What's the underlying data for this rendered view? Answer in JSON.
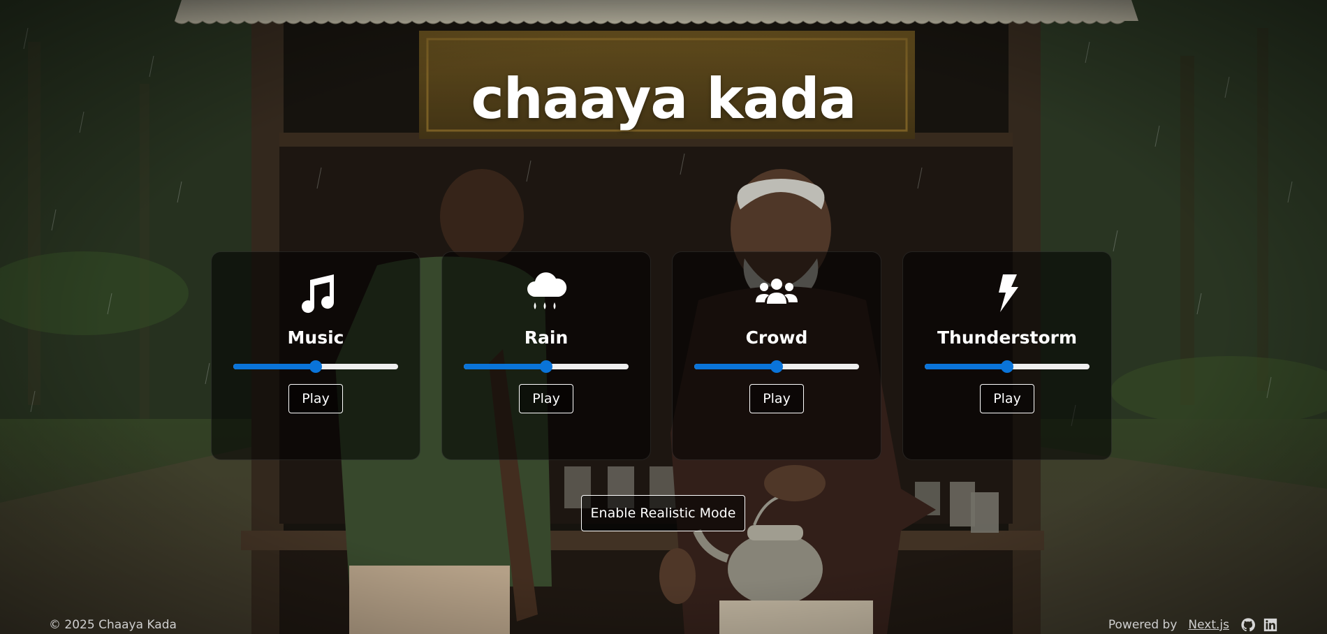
{
  "header": {
    "title": "chaaya kada"
  },
  "sounds": [
    {
      "label": "Music",
      "icon": "music-note-icon",
      "volume_percent": 50,
      "button_label": "Play"
    },
    {
      "label": "Rain",
      "icon": "cloud-rain-icon",
      "volume_percent": 50,
      "button_label": "Play"
    },
    {
      "label": "Crowd",
      "icon": "people-group-icon",
      "volume_percent": 50,
      "button_label": "Play"
    },
    {
      "label": "Thunderstorm",
      "icon": "lightning-bolt-icon",
      "volume_percent": 50,
      "button_label": "Play"
    }
  ],
  "realistic_mode": {
    "label": "Enable Realistic Mode"
  },
  "footer": {
    "copyright": "© 2025 Chaaya Kada",
    "powered_by": "Powered by",
    "framework_link": "Next.js",
    "social_icons": [
      "github-icon",
      "linkedin-icon"
    ]
  },
  "colors": {
    "slider_accent": "#0a74d9",
    "slider_track": "#efefef",
    "card_background": "rgba(0,0,0,0.55)"
  }
}
